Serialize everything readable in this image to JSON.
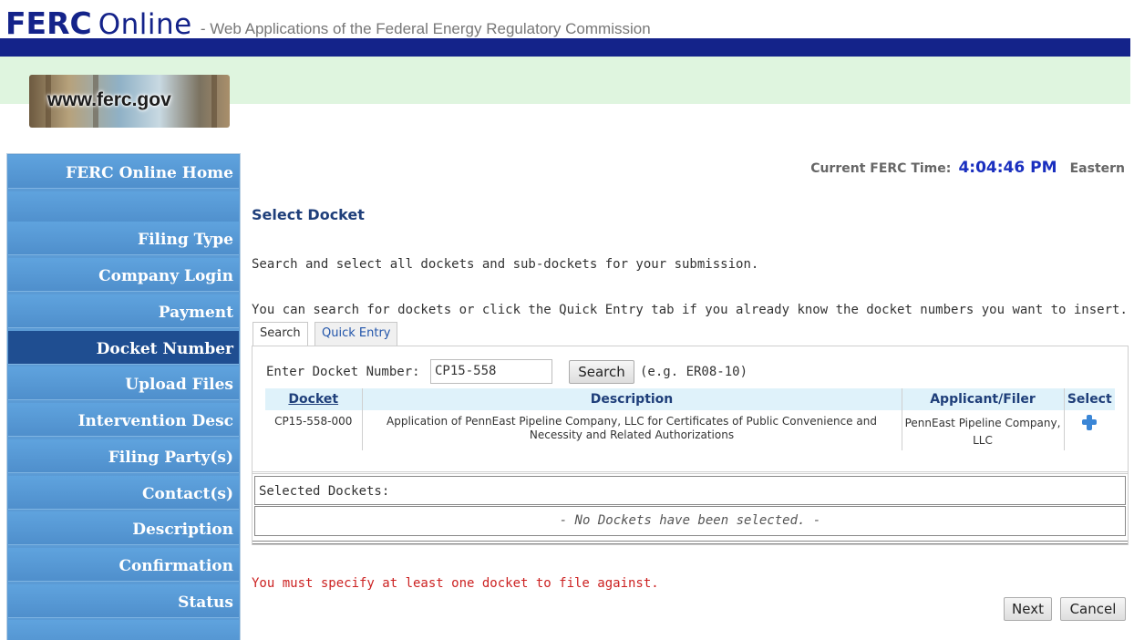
{
  "header": {
    "logo_ferc": "FERC",
    "logo_online": "Online",
    "tagline": "- Web Applications of the Federal Energy Regulatory Commission",
    "site_badge": "www.ferc.gov"
  },
  "sidebar": {
    "items": [
      {
        "label": "FERC Online Home",
        "active": false
      },
      {
        "label": "",
        "active": false
      },
      {
        "label": "Filing Type",
        "active": false
      },
      {
        "label": "Company Login",
        "active": false
      },
      {
        "label": "Payment",
        "active": false
      },
      {
        "label": "Docket Number",
        "active": true
      },
      {
        "label": "Upload Files",
        "active": false
      },
      {
        "label": "Intervention Desc",
        "active": false
      },
      {
        "label": "Filing Party(s)",
        "active": false
      },
      {
        "label": "Contact(s)",
        "active": false
      },
      {
        "label": "Description",
        "active": false
      },
      {
        "label": "Confirmation",
        "active": false
      },
      {
        "label": "Status",
        "active": false
      },
      {
        "label": "",
        "active": false
      }
    ]
  },
  "clock": {
    "label": "Current FERC Time:",
    "time": "4:04:46 PM",
    "zone": "Eastern"
  },
  "main": {
    "title": "Select Docket",
    "intro": "Search and select all dockets and sub-dockets for your submission.",
    "hint": "You can search for dockets or click the Quick Entry tab if you already know the docket numbers you want to insert.",
    "tabs": [
      {
        "label": "Search",
        "active": true
      },
      {
        "label": "Quick Entry",
        "active": false
      }
    ]
  },
  "search": {
    "label": "Enter Docket Number:",
    "value": "CP15-558",
    "button": "Search",
    "example": "(e.g. ER08-10)"
  },
  "results": {
    "columns": [
      "Docket",
      "Description",
      "Applicant/Filer",
      "Select"
    ],
    "rows": [
      {
        "docket": "CP15-558-000",
        "description": "Application of PennEast Pipeline Company, LLC for Certificates of Public Convenience and Necessity and Related Authorizations",
        "applicant": "PennEast Pipeline Company, LLC",
        "select_icon": "plus-icon"
      }
    ]
  },
  "selected": {
    "label": "Selected Dockets:",
    "empty_message": "- No Dockets have been selected. -"
  },
  "error": "You must specify at least one docket to file against.",
  "buttons": {
    "next": "Next",
    "cancel": "Cancel"
  },
  "colors": {
    "brand_navy": "#14238a",
    "sidebar_blue": "#5b9bd5",
    "sidebar_active": "#1f4e91",
    "error_red": "#cc2222",
    "header_green": "#dff5df"
  }
}
